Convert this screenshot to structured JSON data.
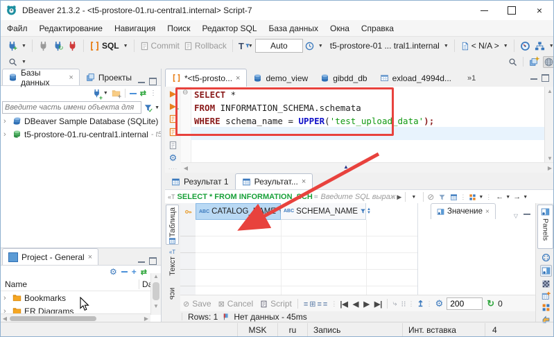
{
  "window": {
    "title": "DBeaver 21.3.2 - <t5-prostore-01.ru-central1.internal> Script-7"
  },
  "menu": {
    "items": [
      {
        "label": "Файл"
      },
      {
        "label": "Редактирование"
      },
      {
        "label": "Навигация"
      },
      {
        "label": "Поиск"
      },
      {
        "label": "Редактор SQL"
      },
      {
        "label": "База данных"
      },
      {
        "label": "Окна"
      },
      {
        "label": "Справка"
      }
    ]
  },
  "toolbar": {
    "sql_label": "SQL",
    "commit_label": "Commit",
    "rollback_label": "Rollback",
    "tx_mode": "Auto",
    "connection": "t5-prostore-01 ... tral1.internal",
    "schema": "< N/A >"
  },
  "db_panel": {
    "tab_databases": "Базы данных",
    "tab_projects": "Проекты",
    "filter_placeholder": "Введите часть имени объекта для",
    "tree": [
      {
        "label": "DBeaver Sample Database (SQLite)",
        "suffix": ""
      },
      {
        "label": "t5-prostore-01.ru-central1.internal",
        "suffix": "- t5"
      }
    ]
  },
  "project_panel": {
    "tab": "Project - General",
    "columns": {
      "name": "Name",
      "date": "Da"
    },
    "tree": [
      {
        "label": "Bookmarks"
      },
      {
        "label": "ER Diagrams"
      }
    ]
  },
  "editor": {
    "tabs": [
      {
        "label": "*<t5-prosto..."
      },
      {
        "label": "demo_view"
      },
      {
        "label": "gibdd_db"
      },
      {
        "label": "exload_4994d..."
      }
    ],
    "overflow_badge": "»1",
    "code": {
      "kw1": "SELECT",
      "rest1": " *",
      "kw2": "FROM",
      "rest2": " INFORMATION_SCHEMA.schemata",
      "kw3": "WHERE",
      "mid3": " schema_name = ",
      "fn3": "UPPER",
      "paren3": "(",
      "str3": "'test_upload_data'",
      "close3": ");"
    }
  },
  "results": {
    "tab1": "Результат 1",
    "tab2": "Результат...",
    "filter_sql": "SELECT * FROM INFORMATION_SCH",
    "filter_placeholder": "Введите SQL выраж",
    "side_tabs": {
      "grid": "Таблица",
      "text": "Текст",
      "record": "Запись"
    },
    "grid": {
      "type_prefix": "ABC",
      "col1": "CATALOG_NAME",
      "col2": "SCHEMA_NAME"
    },
    "value_panel": {
      "tab": "Значение"
    },
    "panels_strip": {
      "label": "Panels"
    },
    "footer": {
      "save": "Save",
      "cancel": "Cancel",
      "script": "Script",
      "fetch_size": "200",
      "refresh_count": "0"
    },
    "status": {
      "rows": "Rows: 1",
      "message": "Нет данных - 45ms"
    }
  },
  "status_bar": {
    "timezone": "MSK",
    "language": "ru",
    "edit_mode": "Запись",
    "insert_mode": "Инт. вставка",
    "caret_line": "4"
  },
  "colors": {
    "annotation_red": "#e8423d",
    "selection_blue": "#b9d9f4",
    "keyword": "#8b1c1c",
    "function": "#1010c8",
    "string_green": "#119911",
    "filter_sql_green": "#18a038"
  }
}
